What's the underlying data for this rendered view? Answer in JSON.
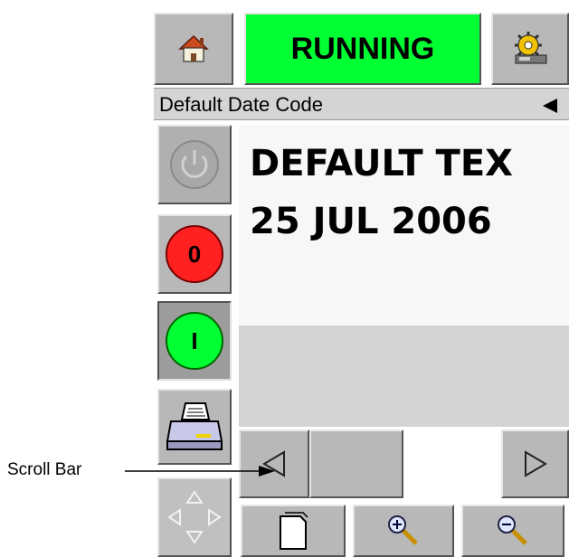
{
  "header": {
    "status_label": "RUNNING",
    "status_color": "#00ff33",
    "home_icon": "home-icon",
    "setup_icon": "setup-gear-icon"
  },
  "job_bar": {
    "job_name": "Default Date Code",
    "arrow_icon": "triangle-left-icon"
  },
  "side_buttons": [
    {
      "name": "power-button",
      "icon": "power-icon",
      "label": ""
    },
    {
      "name": "stop-button",
      "icon": "stop-icon",
      "label": "0"
    },
    {
      "name": "start-button",
      "icon": "start-icon",
      "label": "I"
    },
    {
      "name": "print-button",
      "icon": "printer-icon"
    },
    {
      "name": "navigate-button",
      "icon": "four-way-arrows-icon"
    }
  ],
  "message_preview": {
    "line1": "DEFAULT TEX",
    "line2": "25 JUL 2006"
  },
  "scroll_bar": {
    "left_icon": "scroll-left-icon",
    "right_icon": "scroll-right-icon"
  },
  "bottom_toolbar": {
    "new_icon": "new-document-icon",
    "zoom_in_icon": "zoom-in-icon",
    "zoom_out_icon": "zoom-out-icon"
  },
  "annotation": {
    "label": "Scroll Bar"
  }
}
